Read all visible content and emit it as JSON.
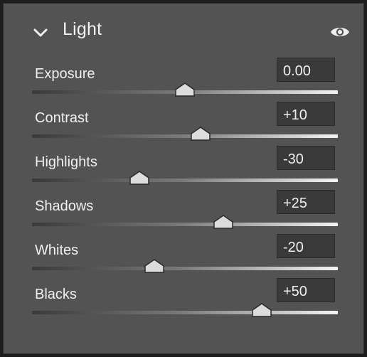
{
  "panel": {
    "title": "Light",
    "chevron_icon": "chevron-down-icon",
    "visibility_icon": "eye-icon"
  },
  "sliders": [
    {
      "label": "Exposure",
      "value": "0.00",
      "position": 0.5
    },
    {
      "label": "Contrast",
      "value": "+10",
      "position": 0.55
    },
    {
      "label": "Highlights",
      "value": "-30",
      "position": 0.35
    },
    {
      "label": "Shadows",
      "value": "+25",
      "position": 0.625
    },
    {
      "label": "Whites",
      "value": "-20",
      "position": 0.4
    },
    {
      "label": "Blacks",
      "value": "+50",
      "position": 0.75
    }
  ],
  "colors": {
    "panel_background": "#535353",
    "field_background": "#3a3a3a",
    "text": "#f0f0f0"
  }
}
